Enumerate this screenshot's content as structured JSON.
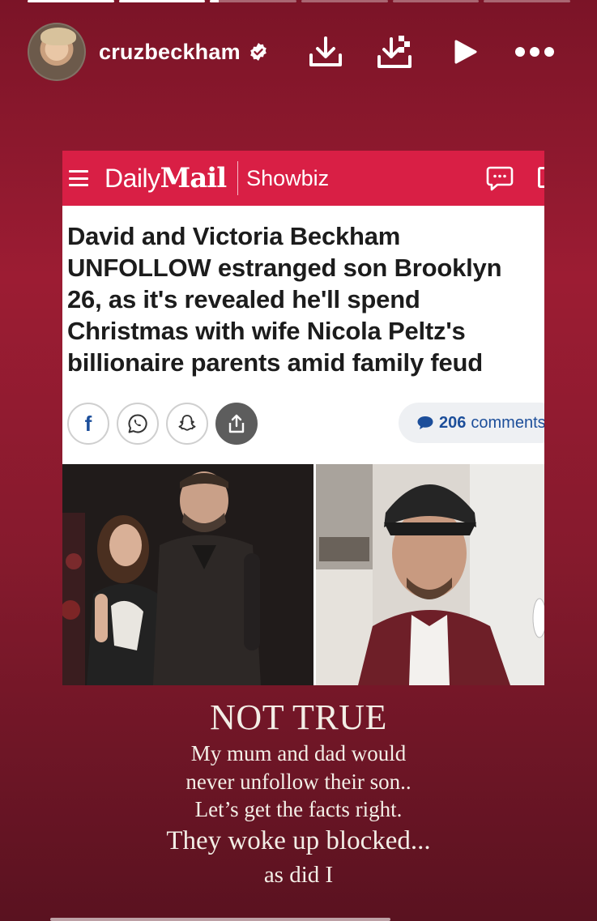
{
  "story": {
    "progress": [
      1,
      1,
      0.1,
      0,
      0,
      0
    ],
    "user": {
      "username": "cruzbeckham",
      "verified": true
    },
    "icons": [
      "download-icon",
      "save-icon",
      "play-icon",
      "more-icon"
    ]
  },
  "article": {
    "publication_light": "Daily",
    "publication_bold": "Mail",
    "section": "Showbiz",
    "headline": "David and Victoria Beckham UNFOLLOW estranged son Brooklyn 26, as it's revealed he'll spend Christmas with wife Nicola Peltz's billionaire parents amid family feud",
    "comments_count": "206",
    "comments_label": "comments",
    "share_icons": [
      "facebook-icon",
      "whatsapp-icon",
      "snapchat-icon",
      "share-icon"
    ],
    "accent_color": "#d91f45"
  },
  "caption": {
    "title": "NOT TRUE",
    "line1": "My mum and dad would",
    "line2": "never unfollow their son..",
    "line3": "Let’s get the facts right.",
    "line4": "They woke up blocked...",
    "line5": "as did I"
  }
}
